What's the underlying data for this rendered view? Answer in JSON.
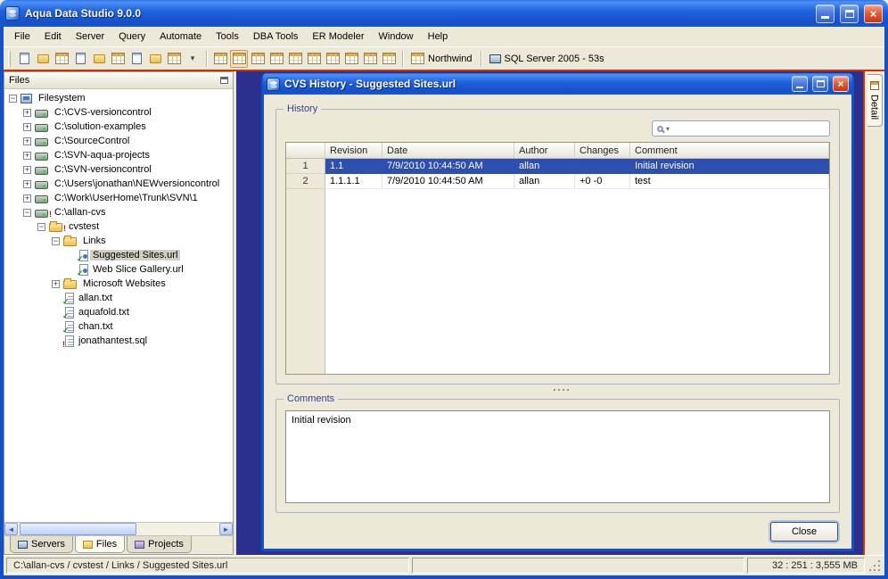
{
  "window": {
    "title": "Aqua Data Studio 9.0.0"
  },
  "menu": {
    "items": [
      "File",
      "Edit",
      "Server",
      "Query",
      "Automate",
      "Tools",
      "DBA Tools",
      "ER Modeler",
      "Window",
      "Help"
    ]
  },
  "toolbar": {
    "main_icons": [
      "register-server",
      "server-properties",
      "windows-list",
      "schema-browser",
      "query-analyzer",
      "table-data-editor",
      "import-tool",
      "er-modeler",
      "automation",
      "window-dropdown"
    ],
    "window_icons": [
      "active-documents"
    ],
    "grid_icons": [
      "results-grid",
      "results-text",
      "results-pivot",
      "results-form",
      "results-html",
      "results-excel",
      "results-xml",
      "results-chart",
      "results-export"
    ],
    "database_label": "Northwind",
    "server_label": "SQL Server 2005 - 53s"
  },
  "files_panel": {
    "header": "Files",
    "tree": [
      {
        "label": "Filesystem",
        "level": 0,
        "exp": "minus",
        "icon": "computer"
      },
      {
        "label": "C:\\CVS-versioncontrol",
        "level": 1,
        "exp": "plus",
        "icon": "drive"
      },
      {
        "label": "C:\\solution-examples",
        "level": 1,
        "exp": "plus",
        "icon": "drive"
      },
      {
        "label": "C:\\SourceControl",
        "level": 1,
        "exp": "plus",
        "icon": "drive"
      },
      {
        "label": "C:\\SVN-aqua-projects",
        "level": 1,
        "exp": "plus",
        "icon": "drive"
      },
      {
        "label": "C:\\SVN-versioncontrol",
        "level": 1,
        "exp": "plus",
        "icon": "drive"
      },
      {
        "label": "C:\\Users\\jonathan\\NEWversioncontrol",
        "level": 1,
        "exp": "plus",
        "icon": "drive"
      },
      {
        "label": "C:\\Work\\UserHome\\Trunk\\SVN\\1",
        "level": 1,
        "exp": "plus",
        "icon": "drive"
      },
      {
        "label": "C:\\allan-cvs",
        "level": 1,
        "exp": "minus",
        "icon": "drive",
        "marker": "excl"
      },
      {
        "label": "cvstest",
        "level": 2,
        "exp": "minus",
        "icon": "folder",
        "marker": "excl"
      },
      {
        "label": "Links",
        "level": 3,
        "exp": "minus",
        "icon": "folder"
      },
      {
        "label": "Suggested Sites.url",
        "level": 4,
        "icon": "url",
        "marker": "check",
        "selected": true
      },
      {
        "label": "Web Slice Gallery.url",
        "level": 4,
        "icon": "url",
        "marker": "check"
      },
      {
        "label": "Microsoft Websites",
        "level": 3,
        "exp": "plus",
        "icon": "folder"
      },
      {
        "label": "allan.txt",
        "level": 3,
        "icon": "file",
        "marker": "check"
      },
      {
        "label": "aquafold.txt",
        "level": 3,
        "icon": "file",
        "marker": "check"
      },
      {
        "label": "chan.txt",
        "level": 3,
        "icon": "file",
        "marker": "check"
      },
      {
        "label": "jonathantest.sql",
        "level": 3,
        "icon": "sql",
        "marker": "excl"
      }
    ],
    "tabs": [
      {
        "label": "Servers",
        "active": false
      },
      {
        "label": "Files",
        "active": true
      },
      {
        "label": "Projects",
        "active": false
      }
    ]
  },
  "dialog": {
    "title": "CVS History - Suggested Sites.url",
    "history_label": "History",
    "comments_label": "Comments",
    "comments_text": "Initial revision",
    "close_label": "Close",
    "search_value": "",
    "table": {
      "columns": [
        "Revision",
        "Date",
        "Author",
        "Changes",
        "Comment"
      ],
      "rows": [
        {
          "num": "1",
          "revision": "1.1",
          "date": "7/9/2010 10:44:50 AM",
          "author": "allan",
          "changes": "",
          "comment": "Initial revision",
          "selected": true
        },
        {
          "num": "2",
          "revision": "1.1.1.1",
          "date": "7/9/2010 10:44:50 AM",
          "author": "allan",
          "changes": "+0 -0",
          "comment": "test",
          "selected": false
        }
      ]
    }
  },
  "detail_tab": {
    "label": "Detail"
  },
  "status": {
    "path": "C:\\allan-cvs / cvstest / Links / Suggested Sites.url",
    "memory": "32 : 251 : 3,555 MB"
  }
}
